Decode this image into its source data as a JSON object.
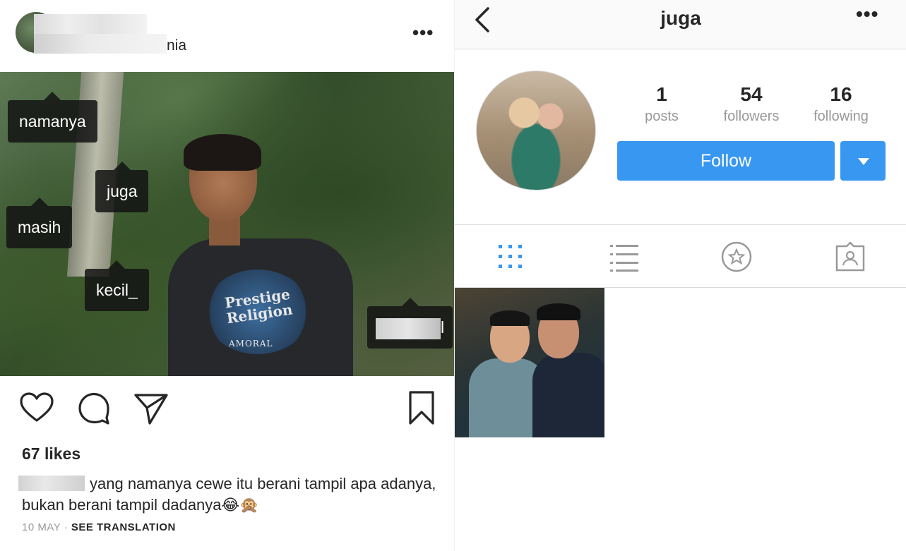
{
  "post": {
    "username_suffix": "nia",
    "tags": [
      "namanya",
      "juga",
      "masih",
      "kecil_",
      "l"
    ],
    "shirt_text": "Prestige Religion",
    "shirt_sub": "AMORAL",
    "likes": "67 likes",
    "caption": "yang namanya cewe itu berani tampil apa adanya, bukan berani tampil dadanya",
    "caption_emoji": "😂🙊",
    "date": "10 MAY",
    "separator": "·",
    "see_translation": "SEE TRANSLATION"
  },
  "profile": {
    "title": "juga",
    "stats": [
      {
        "num": "1",
        "label": "posts"
      },
      {
        "num": "54",
        "label": "followers"
      },
      {
        "num": "16",
        "label": "following"
      }
    ],
    "follow_label": "Follow"
  },
  "icons": {
    "heart": "heart-icon",
    "comment": "comment-icon",
    "share": "share-icon",
    "bookmark": "bookmark-icon",
    "back": "chevron-left-icon",
    "more": "more-icon",
    "grid": "grid-icon",
    "list": "list-icon",
    "star": "star-icon",
    "tagged": "tagged-icon"
  },
  "colors": {
    "accent": "#3897f0",
    "text": "#262626",
    "muted": "#999999"
  }
}
